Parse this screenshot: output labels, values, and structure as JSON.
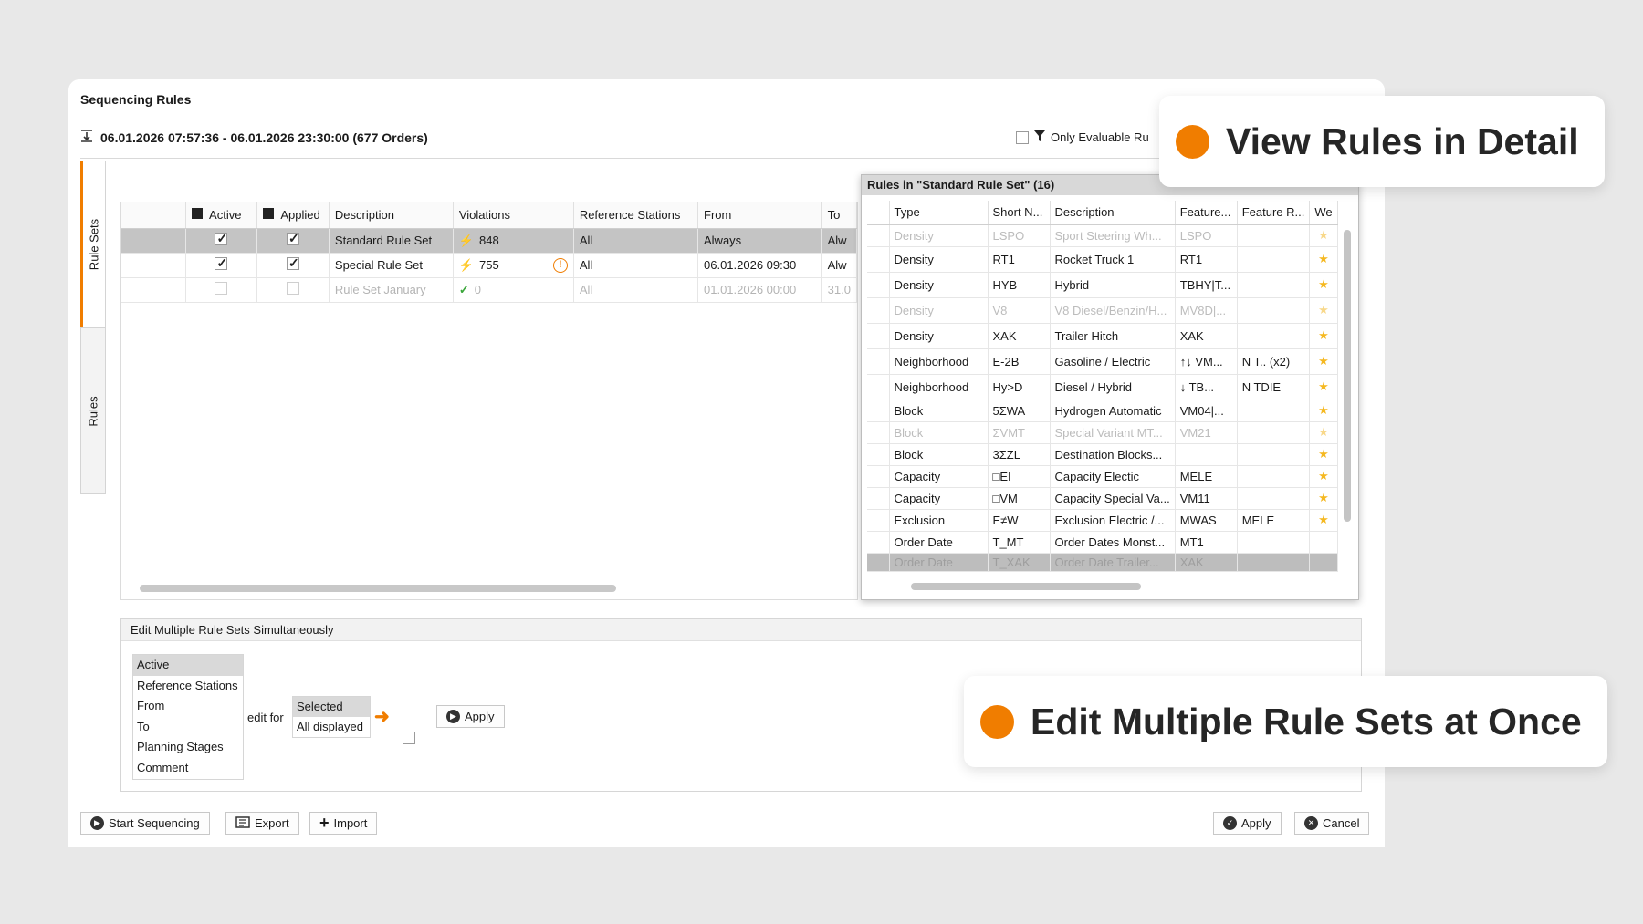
{
  "window": {
    "title": "Sequencing Rules"
  },
  "header": {
    "date_range": "06.01.2026 07:57:36 - 06.01.2026 23:30:00 (677 Orders)",
    "only_evaluable": "Only Evaluable Ru"
  },
  "tabs": {
    "rule_sets": "Rule Sets",
    "rules": "Rules"
  },
  "rule_sets_grid": {
    "columns": {
      "active": "Active",
      "applied": "Applied",
      "description": "Description",
      "violations": "Violations",
      "reference_stations": "Reference Stations",
      "from": "From",
      "to": "To"
    },
    "rows": [
      {
        "active": true,
        "applied": true,
        "description": "Standard Rule Set",
        "violations": "848",
        "reference_stations": "All",
        "from": "Always",
        "to": "Alw",
        "warning": ""
      },
      {
        "active": true,
        "applied": true,
        "description": "Special Rule Set",
        "violations": "755",
        "reference_stations": "All",
        "from": "06.01.2026 09:30",
        "to": "Alw",
        "warning": "!"
      },
      {
        "active": false,
        "applied": false,
        "description": "Rule Set January",
        "violations": "0",
        "reference_stations": "All",
        "from": "01.01.2026 00:00",
        "to": "31.0",
        "warning": ""
      }
    ]
  },
  "rules_panel": {
    "title": "Rules in \"Standard Rule Set\" (16)",
    "columns": {
      "type": "Type",
      "short": "Short N...",
      "description": "Description",
      "feature1": "Feature...",
      "feature2": "Feature R...",
      "weight": "We"
    },
    "rows": [
      {
        "type": "Density",
        "short": "LSPO",
        "description": "Sport Steering Wh...",
        "feature1": "LSPO",
        "feature2": "",
        "dim": true
      },
      {
        "type": "Density",
        "short": "RT1",
        "description": "Rocket Truck 1",
        "feature1": "RT1",
        "feature2": "",
        "dim": false
      },
      {
        "type": "Density",
        "short": "HYB",
        "description": "Hybrid",
        "feature1": "TBHY|T...",
        "feature2": "",
        "dim": false
      },
      {
        "type": "Density",
        "short": "V8",
        "description": "V8 Diesel/Benzin/H...",
        "feature1": "MV8D|...",
        "feature2": "",
        "dim": true
      },
      {
        "type": "Density",
        "short": "XAK",
        "description": "Trailer Hitch",
        "feature1": "XAK",
        "feature2": "",
        "dim": false
      },
      {
        "type": "Neighborhood",
        "short": "E-2B",
        "description": "Gasoline / Electric",
        "feature1": "↑↓ VM...",
        "feature2": "N T.. (x2)",
        "dim": false
      },
      {
        "type": "Neighborhood",
        "short": "Hy>D",
        "description": "Diesel / Hybrid",
        "feature1": "↓ TB...",
        "feature2": "N TDIE",
        "dim": false
      },
      {
        "type": "Block",
        "short": "5ΣWA",
        "description": "Hydrogen Automatic",
        "feature1": "VM04|...",
        "feature2": "",
        "dim": false
      },
      {
        "type": "Block",
        "short": "ΣVMT",
        "description": "Special Variant MT...",
        "feature1": "VM21",
        "feature2": "",
        "dim": true
      },
      {
        "type": "Block",
        "short": "3ΣZL",
        "description": "Destination Blocks...",
        "feature1": "",
        "feature2": "",
        "dim": false
      },
      {
        "type": "Capacity",
        "short": "□EI",
        "description": "Capacity Electic",
        "feature1": "MELE",
        "feature2": "",
        "dim": false
      },
      {
        "type": "Capacity",
        "short": "□VM",
        "description": "Capacity Special Va...",
        "feature1": "VM11",
        "feature2": "",
        "dim": false
      },
      {
        "type": "Exclusion",
        "short": "E≠W",
        "description": "Exclusion Electric /...",
        "feature1": "MWAS",
        "feature2": "MELE",
        "dim": false
      },
      {
        "type": "Order Date",
        "short": "T_MT",
        "description": "Order Dates Monst...",
        "feature1": "MT1",
        "feature2": "",
        "dim": false,
        "noweight": true
      },
      {
        "type": "Order Date",
        "short": "T_XAK",
        "description": "Order Date Trailer...",
        "feature1": "XAK",
        "feature2": "",
        "dim": true,
        "sel": true,
        "noweight": true
      }
    ]
  },
  "edit_panel": {
    "title": "Edit Multiple Rule Sets Simultaneously",
    "fields": [
      "Active",
      "Reference Stations",
      "From",
      "To",
      "Planning Stages",
      "Comment"
    ],
    "edit_for_label": "edit for",
    "scope": [
      "Selected",
      "All displayed"
    ],
    "apply_label": "Apply"
  },
  "footer": {
    "start": "Start Sequencing",
    "export": "Export",
    "import": "Import",
    "apply": "Apply",
    "cancel": "Cancel"
  },
  "callouts": {
    "view": "View Rules in Detail",
    "edit": "Edit Multiple Rule Sets at Once"
  },
  "colors": {
    "accent": "#f07d00",
    "star": "#f5b820"
  }
}
